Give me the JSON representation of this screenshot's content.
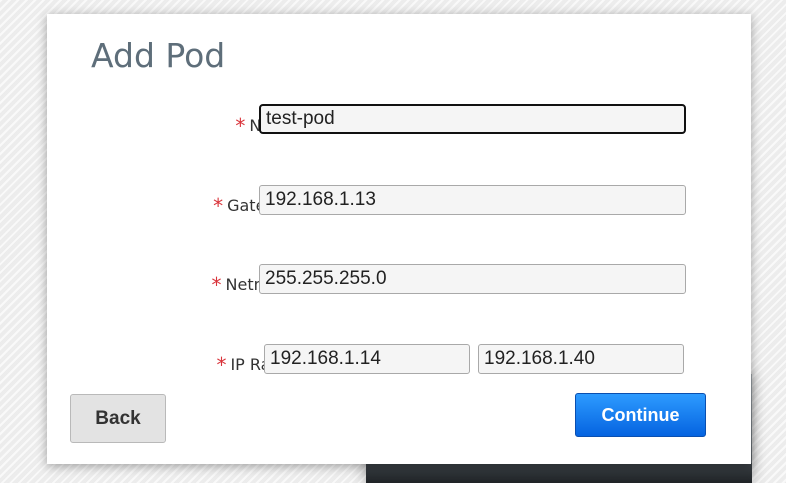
{
  "dialog": {
    "title": "Add Pod"
  },
  "form": {
    "required_marker": "*",
    "name": {
      "label": "Name:",
      "value": "test-pod"
    },
    "gateway": {
      "label": "Gateway:",
      "value": "192.168.1.13"
    },
    "netmask": {
      "label": "Netmask:",
      "value": "255.255.255.0"
    },
    "ip_range": {
      "label": "IP Range:",
      "start": "192.168.1.14",
      "end": "192.168.1.40"
    }
  },
  "buttons": {
    "back": "Back",
    "continue": "Continue"
  },
  "colors": {
    "title": "#5e6e7a",
    "required": "#d9343b",
    "primary_button": "#0a7df5"
  }
}
